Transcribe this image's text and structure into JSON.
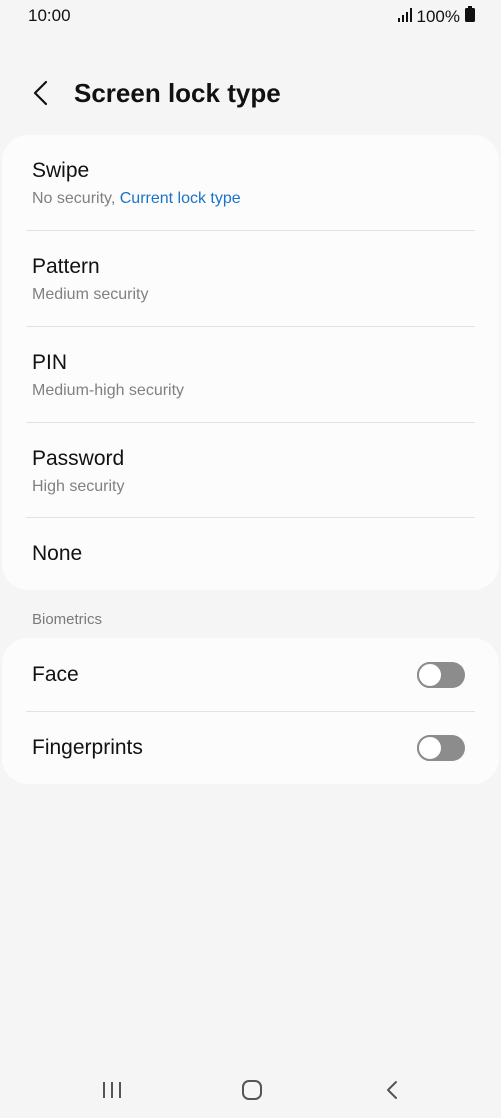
{
  "status_bar": {
    "time": "10:00",
    "battery": "100%",
    "icons": [
      "signal-icon",
      "battery-icon"
    ]
  },
  "header": {
    "title": "Screen lock type",
    "back_icon": "back-arrow-icon"
  },
  "lock_types": [
    {
      "title": "Swipe",
      "subtitle": "No security,",
      "current": "Current lock type"
    },
    {
      "title": "Pattern",
      "subtitle": "Medium security"
    },
    {
      "title": "PIN",
      "subtitle": "Medium-high security"
    },
    {
      "title": "Password",
      "subtitle": "High security"
    },
    {
      "title": "None"
    }
  ],
  "biometrics": {
    "section_label": "Biometrics",
    "items": [
      {
        "title": "Face",
        "enabled": false
      },
      {
        "title": "Fingerprints",
        "enabled": false
      }
    ]
  },
  "nav_bar": {
    "icons": [
      "recent-apps-icon",
      "home-icon",
      "back-icon"
    ]
  },
  "colors": {
    "background": "#f5f5f5",
    "card": "#fcfcfc",
    "accent": "#1a73c8",
    "toggle_off": "#8c8c8c"
  }
}
